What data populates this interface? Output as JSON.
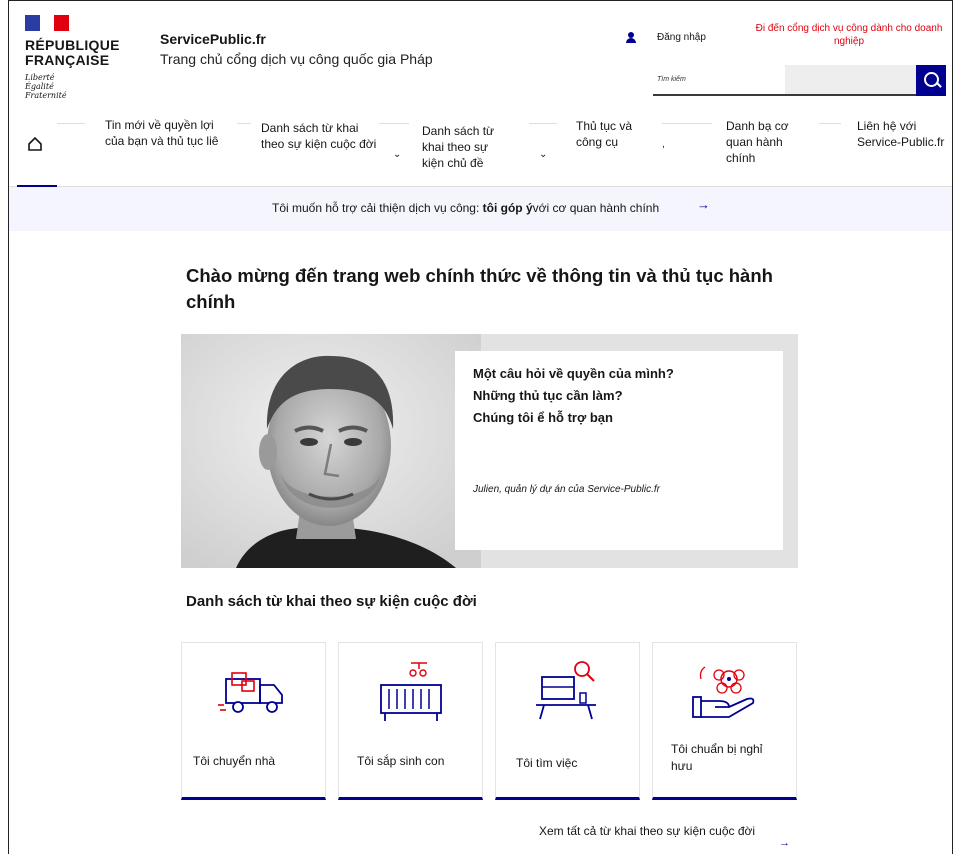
{
  "header": {
    "republic_line1": "RÉPUBLIQUE",
    "republic_line2": "FRANÇAISE",
    "motto_1": "Liberté",
    "motto_2": "Égalité",
    "motto_3": "Fraternité",
    "site_name": "ServicePublic.fr",
    "site_tagline": "Trang chủ cổng dịch vụ công quốc gia Pháp",
    "login_label": "Đăng nhập",
    "business_link": "Đi đến cổng dịch vụ công dành cho doanh nghiệp",
    "search_placeholder": "Tìm kiếm",
    "accent_color": "#000091",
    "red_color": "#e1000f"
  },
  "nav": {
    "items": [
      "Tin mới về quyền lợi của bạn và thủ tục liê",
      "Danh sách từ khai theo sự kiện cuộc đời",
      "Danh sách từ khai theo sự kiện chủ đề",
      "Thủ tục và công cụ",
      "Danh bạ cơ quan hành chính",
      "Liên hệ với Service-Public.fr"
    ]
  },
  "feedback": {
    "text_before": "Tôi muốn hỗ trợ cải thiện dịch vụ công: ",
    "text_bold": "tôi góp ý",
    "text_after": "với cơ quan hành chính"
  },
  "hero": {
    "title": "Chào mừng đến trang web chính thức về thông tin và thủ tục hành chính",
    "q1": "Một câu hỏi về quyền của mình?",
    "q2": "Những thủ tục cần làm?",
    "q3": "Chúng tôi ể hỗ trợ bạn",
    "signature": "Julien, quản lý dự án của Service-Public.fr"
  },
  "life_events": {
    "title": "Danh sách từ khai theo sự kiện cuộc đời",
    "cards": [
      {
        "label": "Tôi chuyển nhà",
        "icon": "moving-truck-icon"
      },
      {
        "label": "Tôi sắp sinh con",
        "icon": "baby-crib-icon"
      },
      {
        "label": "Tôi tìm việc",
        "icon": "job-search-desk-icon"
      },
      {
        "label": "Tôi chuẩn bị nghỉ hưu",
        "icon": "hand-flower-icon"
      }
    ],
    "see_all": "Xem tất cả từ khai theo sự kiện cuộc đời"
  }
}
